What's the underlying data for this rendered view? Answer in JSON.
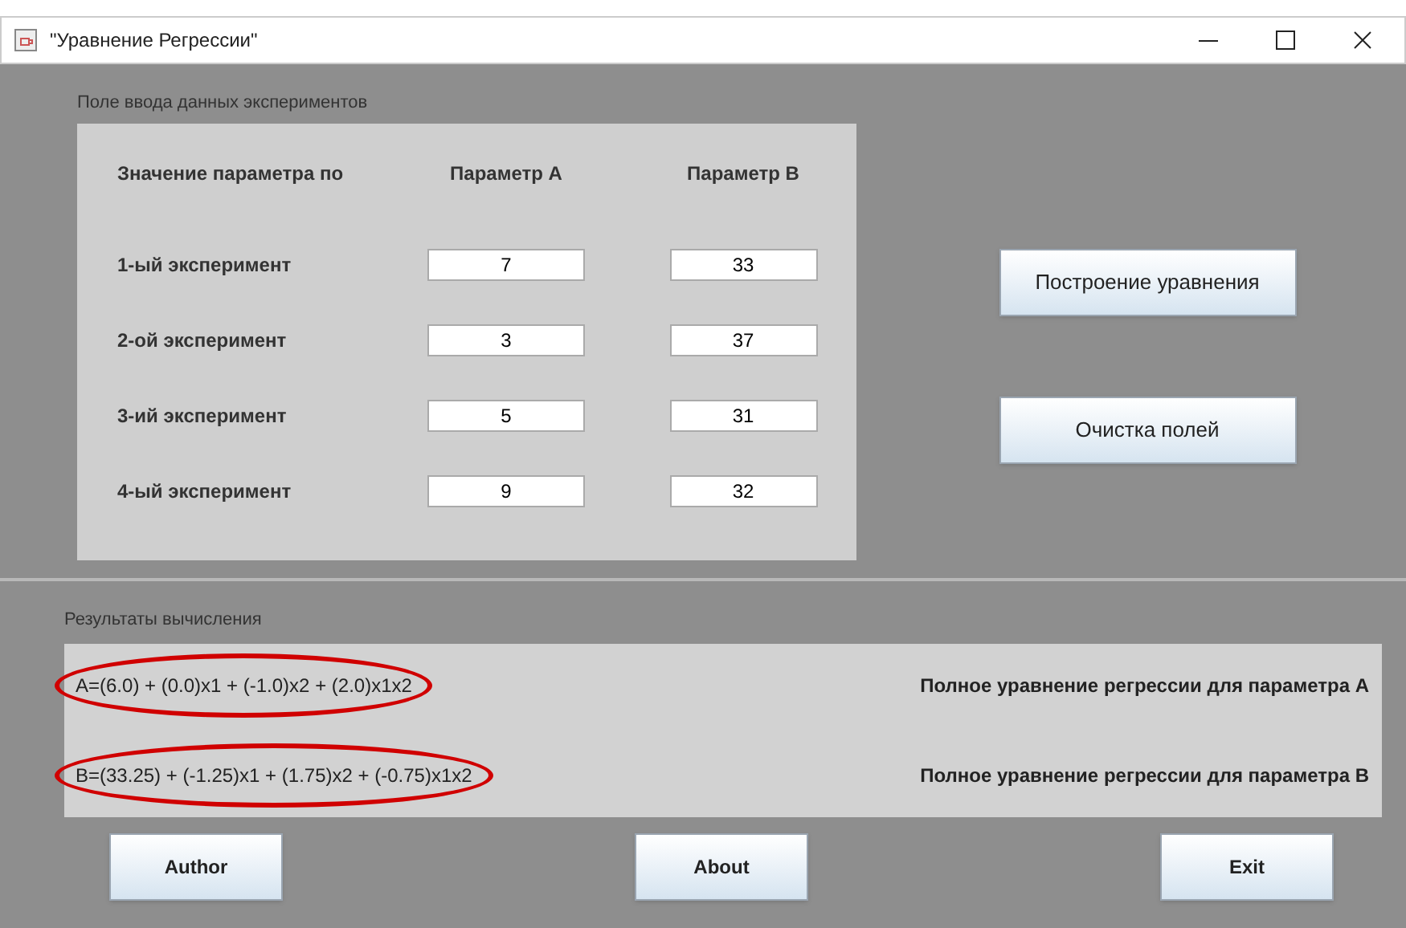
{
  "window": {
    "title": "\"Уравнение Регрессии\""
  },
  "input_panel": {
    "title": "Поле ввода данных экспериментов",
    "header": [
      "Значение параметра по",
      "Параметр А",
      "Параметр В"
    ],
    "rows": [
      {
        "label": "1-ый эксперимент",
        "a": "7",
        "b": "33"
      },
      {
        "label": "2-ой эксперимент",
        "a": "3",
        "b": "37"
      },
      {
        "label": "3-ий эксперимент",
        "a": "5",
        "b": "31"
      },
      {
        "label": "4-ый эксперимент",
        "a": "9",
        "b": "32"
      }
    ]
  },
  "actions": [
    "Построение уравнения",
    "Очистка полей"
  ],
  "results": {
    "title": "Результаты вычисления",
    "rows": [
      {
        "formula": "A=(6.0) + (0.0)x1 + (-1.0)x2 + (2.0)x1x2",
        "description": "Полное уравнение регрессии для параметра А",
        "circled": true
      },
      {
        "formula": "B=(33.25) + (-1.25)x1 + (1.75)x2 + (-0.75)x1x2",
        "description": "Полное уравнение регрессии для параметра В",
        "circled": true
      }
    ]
  },
  "buttons": [
    "Author",
    "About",
    "Exit"
  ]
}
